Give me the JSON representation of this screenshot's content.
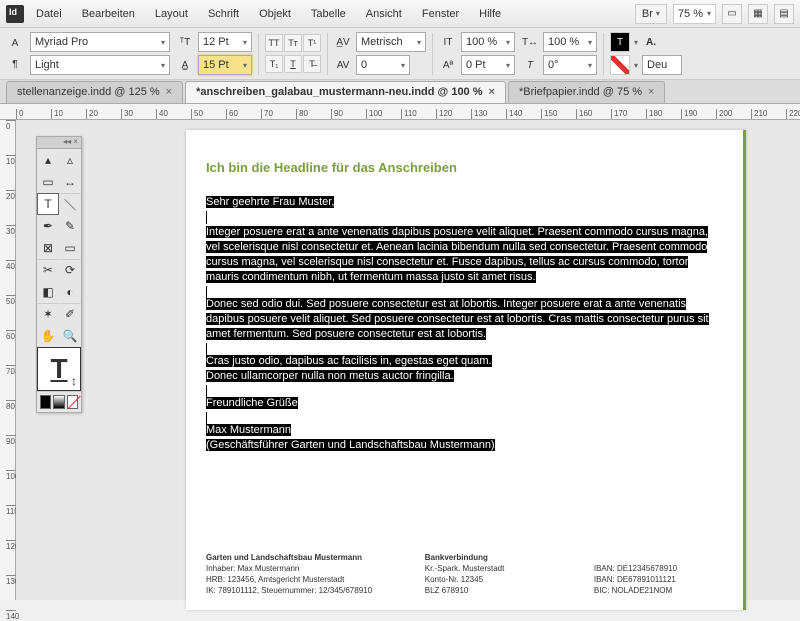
{
  "menu": {
    "items": [
      "Datei",
      "Bearbeiten",
      "Layout",
      "Schrift",
      "Objekt",
      "Tabelle",
      "Ansicht",
      "Fenster",
      "Hilfe"
    ],
    "br": "Br",
    "zoom": "75 %"
  },
  "ctrl": {
    "font": "Myriad Pro",
    "style": "Light",
    "size": "12 Pt",
    "leading": "15 Pt",
    "kerning": "Metrisch",
    "tracking": "0",
    "vscale": "100 %",
    "hscale": "100 %",
    "baseline": "0 Pt",
    "skew": "0°",
    "lang": "Deu"
  },
  "tabs": [
    {
      "label": "stellenanzeige.indd @ 125 %"
    },
    {
      "label": "*anschreiben_galabau_mustermann-neu.indd @ 100 %",
      "active": true
    },
    {
      "label": "*Briefpapier.indd @ 75 %"
    }
  ],
  "ruler_ticks": [
    0,
    10,
    20,
    30,
    40,
    50,
    60,
    70,
    80,
    90,
    100,
    110,
    120,
    130,
    140,
    150,
    160,
    170,
    180,
    190,
    200,
    210,
    220
  ],
  "vruler_ticks": [
    0,
    10,
    20,
    30,
    40,
    50,
    60,
    70,
    80,
    90,
    100,
    110,
    120,
    130,
    140
  ],
  "doc": {
    "headline": "Ich bin die Headline für das Anschreiben",
    "salutation": "Sehr geehrte Frau Muster,",
    "p1": "Integer posuere erat a ante venenatis dapibus posuere velit aliquet. Praesent commodo cursus magna, vel scelerisque nisl consectetur et. Aenean lacinia bibendum nulla sed consectetur. Praesent commodo cursus magna, vel scelerisque nisl consectetur et. Fusce dapibus, tellus ac cursus commodo, tortor mauris condimentum nibh, ut fermentum massa justo sit amet risus.",
    "p2": "Donec sed odio dui. Sed posuere consectetur est at lobortis. Integer posuere erat a ante venenatis dapibus posuere velit aliquet. Sed posuere consectetur est at lobortis. Cras mattis consectetur purus sit amet fermentum. Sed posuere consectetur est at lobortis.",
    "p3": "Cras justo odio, dapibus ac facilisis in, egestas eget quam.",
    "p4": "Donec ullamcorper nulla non metus auctor fringilla.",
    "closing": "Freundliche Grüße",
    "name": "Max Mustermann",
    "role": "(Geschäftsführer Garten und Landschaftsbau Mustermann)"
  },
  "footer": {
    "c1": {
      "title": "Garten und Landschaftsbau Mustermann",
      "l1": "Inhaber: Max Mustermann",
      "l2": "HRB: 123456, Amtsgericht Musterstadt",
      "l3": "IK: 789101112, Steuernummer: 12/345/678910"
    },
    "c2": {
      "title": "Bankverbindung",
      "l1": "Kr.-Spark. Musterstadt",
      "l2": "Konto-Nr. 12345",
      "l3": "BLZ 678910"
    },
    "c3": {
      "l1": "IBAN: DE12345678910",
      "l2": "IBAN: DE67891011121",
      "l3": "BIC: NOLADE21NOM"
    }
  }
}
